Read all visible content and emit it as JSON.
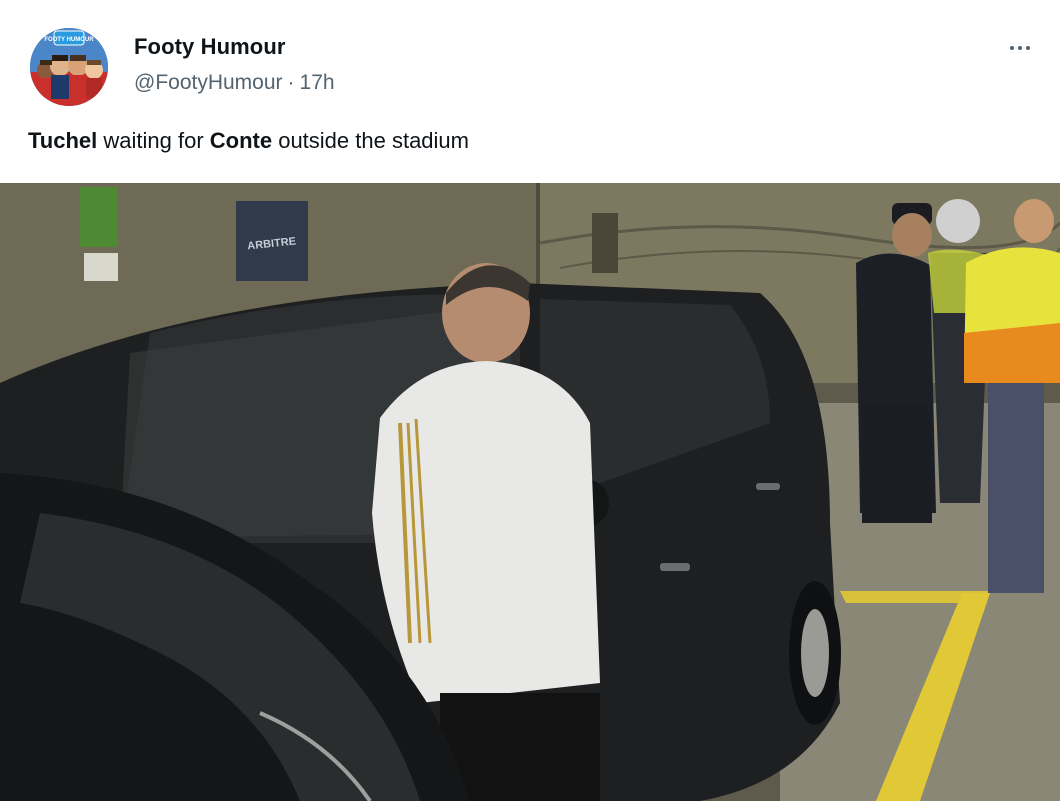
{
  "author": {
    "name": "Footy Humour",
    "handle": "@FootyHumour",
    "separator": "·",
    "time": "17h"
  },
  "avatar": {
    "badge_text": "FOOTY HUMOUR"
  },
  "more_icon": "more-horizontal-icon",
  "tweet": {
    "parts": [
      {
        "text": "Tuchel",
        "bold": true
      },
      {
        "text": " waiting for ",
        "bold": false
      },
      {
        "text": "Conte",
        "bold": true
      },
      {
        "text": " outside the stadium",
        "bold": false
      }
    ]
  },
  "photo": {
    "wall_sign": "ARBITRE",
    "description_icon": "photo-image"
  },
  "colors": {
    "text_primary": "#0f1419",
    "text_secondary": "#536471",
    "background": "#ffffff"
  }
}
